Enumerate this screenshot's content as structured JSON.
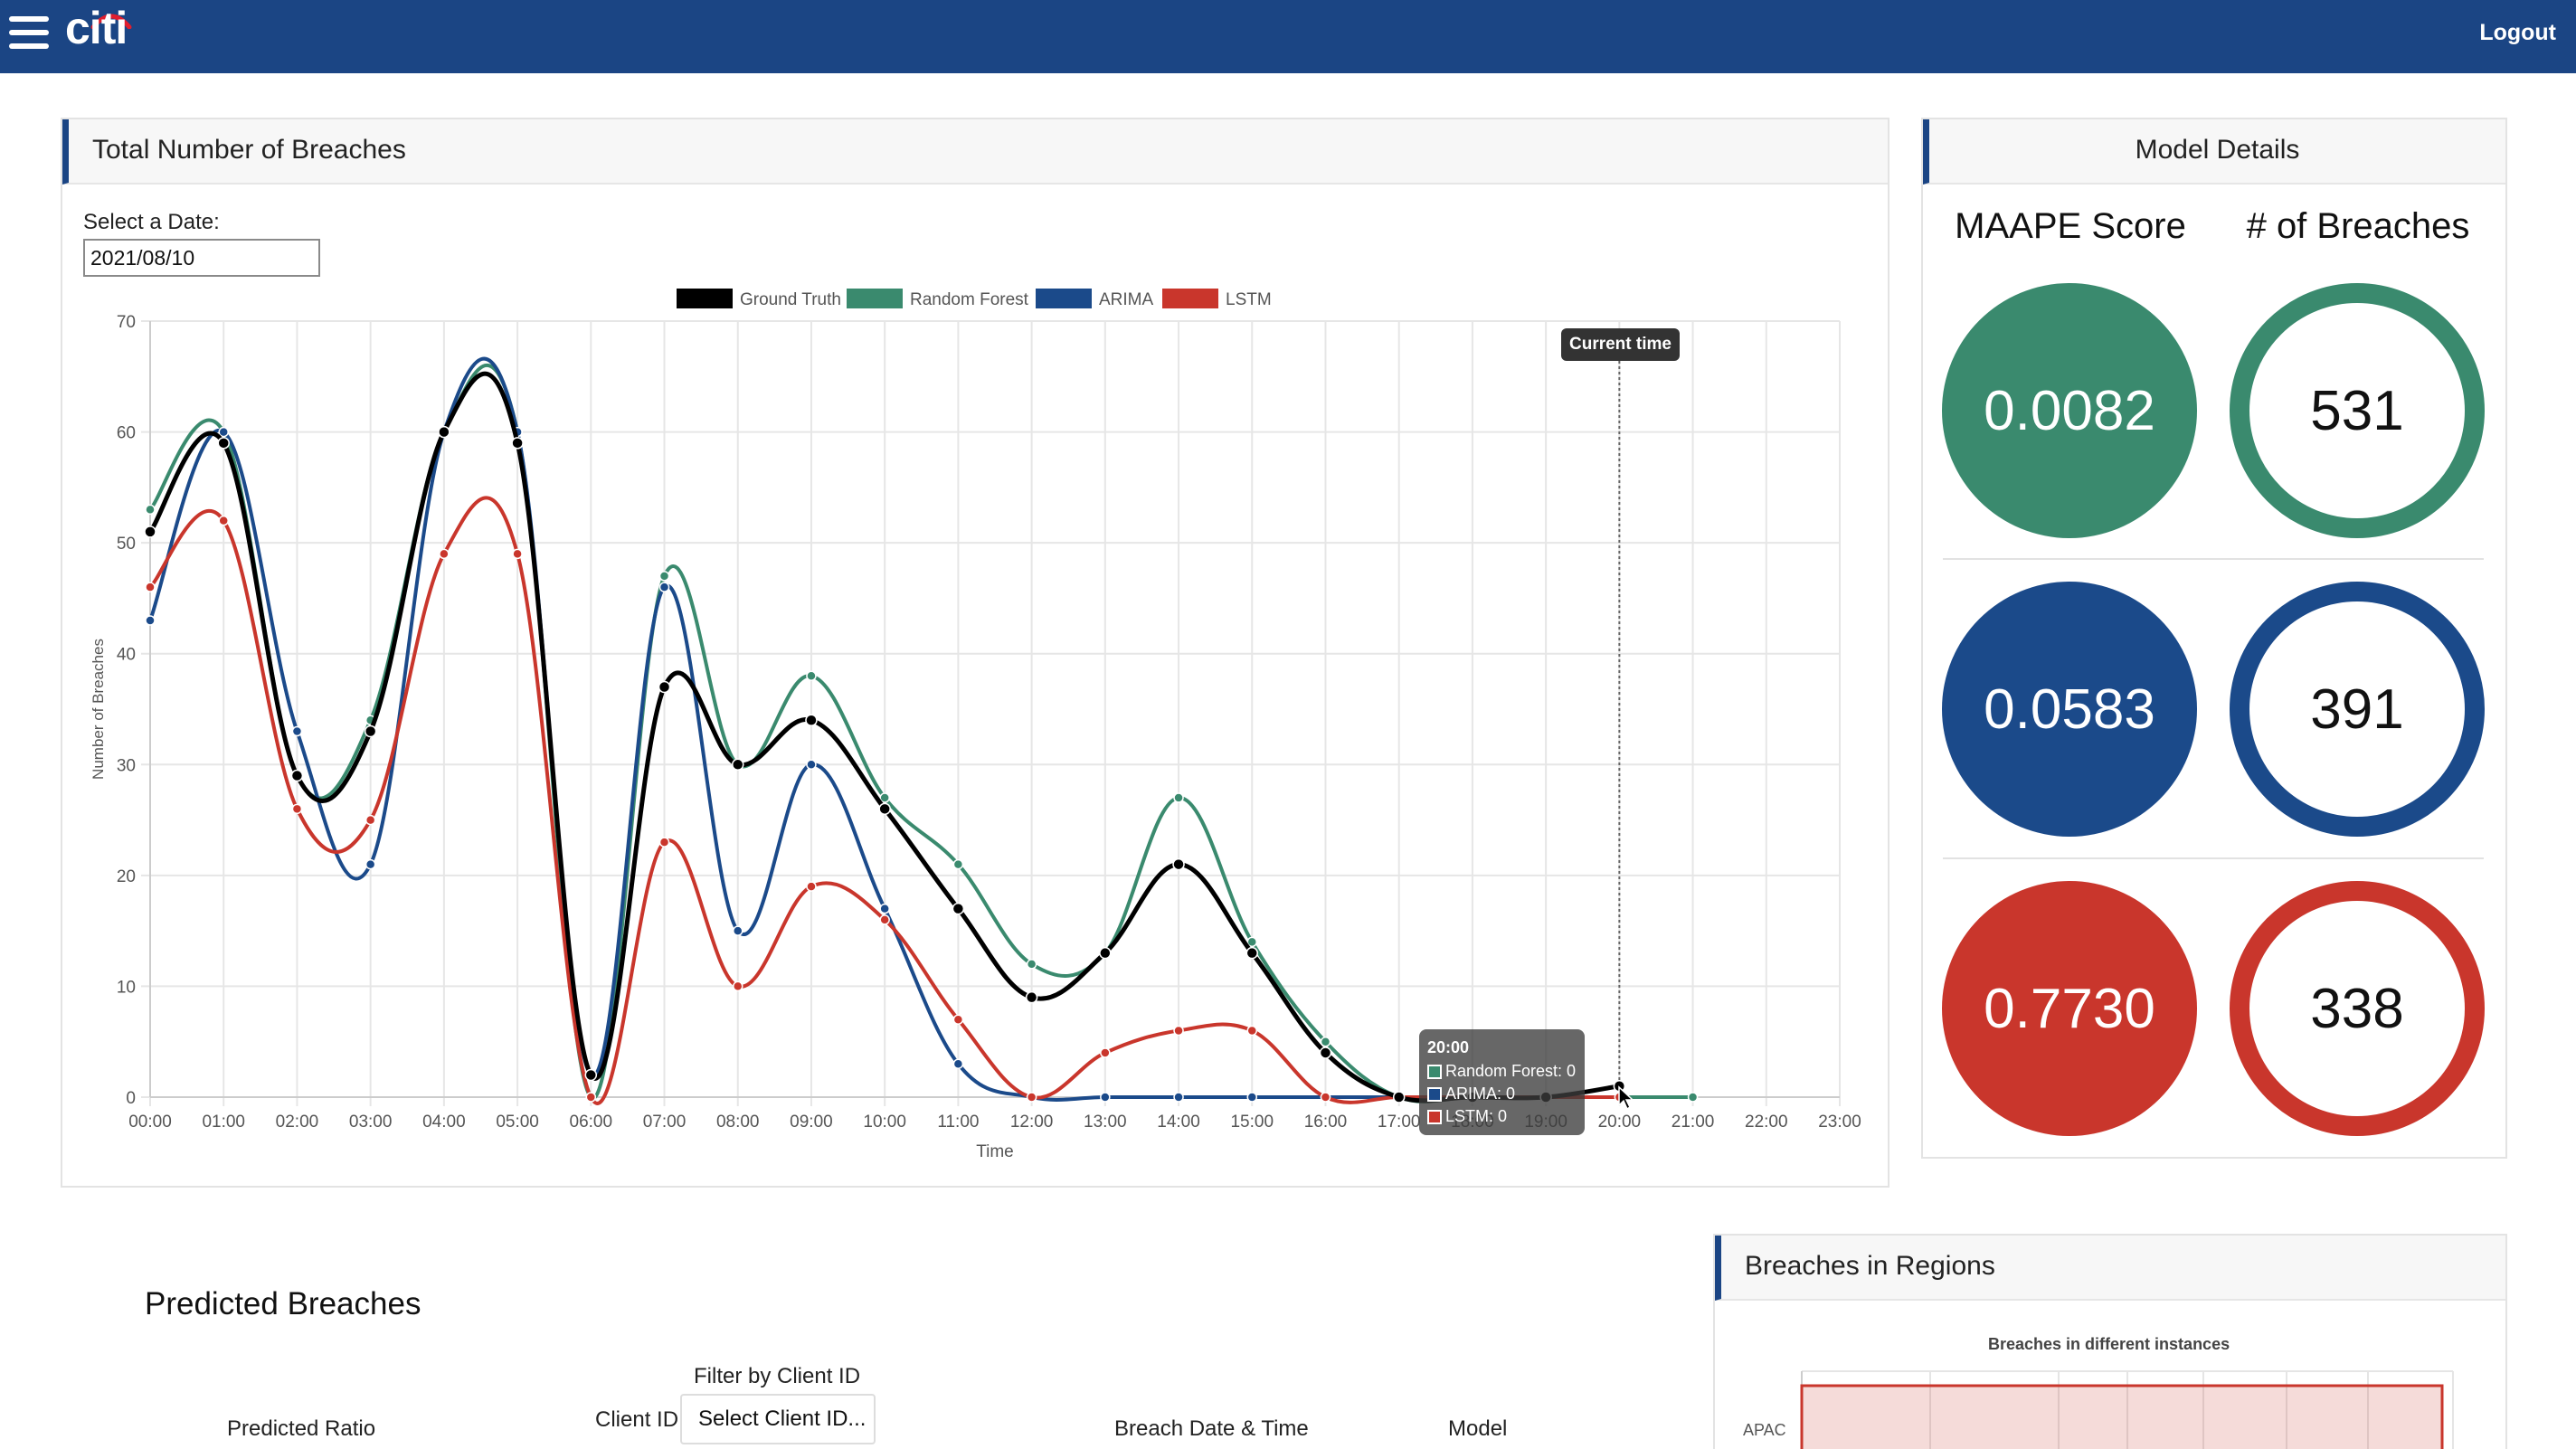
{
  "nav": {
    "logo_text": "citi",
    "logout_label": "Logout",
    "brand_color": "#1b4584"
  },
  "breaches_card": {
    "title": "Total Number of Breaches",
    "date_label": "Select a Date:",
    "date_value": "2021/08/10",
    "current_time_label": "Current time",
    "tooltip": {
      "title": "20:00",
      "rows": [
        "Random Forest: 0",
        "ARIMA: 0",
        "LSTM: 0"
      ]
    }
  },
  "chart_data": {
    "type": "line",
    "xlabel": "Time",
    "ylabel": "Number of Breaches",
    "ylim": [
      0,
      70
    ],
    "yticks": [
      0,
      10,
      20,
      30,
      40,
      50,
      60,
      70
    ],
    "categories": [
      "00:00",
      "01:00",
      "02:00",
      "03:00",
      "04:00",
      "05:00",
      "06:00",
      "07:00",
      "08:00",
      "09:00",
      "10:00",
      "11:00",
      "12:00",
      "13:00",
      "14:00",
      "15:00",
      "16:00",
      "17:00",
      "18:00",
      "19:00",
      "20:00",
      "21:00",
      "22:00",
      "23:00"
    ],
    "grid": true,
    "legend": "top",
    "current_time_marker": "20:00",
    "series": [
      {
        "name": "Random Forest",
        "color": "#3a8a6e",
        "values": [
          53,
          60,
          29,
          34,
          60,
          60,
          0,
          47,
          30,
          38,
          27,
          21,
          12,
          13,
          27,
          14,
          5,
          0,
          0,
          0,
          0,
          0,
          null,
          null
        ]
      },
      {
        "name": "ARIMA",
        "color": "#1b4a8a",
        "values": [
          43,
          60,
          33,
          21,
          60,
          60,
          2,
          46,
          15,
          30,
          17,
          3,
          0,
          0,
          0,
          0,
          0,
          0,
          0,
          0,
          0,
          null,
          null,
          null
        ]
      },
      {
        "name": "LSTM",
        "color": "#c9362c",
        "values": [
          46,
          52,
          26,
          25,
          49,
          49,
          0,
          23,
          10,
          19,
          16,
          7,
          0,
          4,
          6,
          6,
          0,
          0,
          0,
          0,
          0,
          null,
          null,
          null
        ]
      },
      {
        "name": "Ground Truth",
        "color": "#000000",
        "values": [
          51,
          59,
          29,
          33,
          60,
          59,
          2,
          37,
          30,
          34,
          26,
          17,
          9,
          13,
          21,
          13,
          4,
          0,
          0,
          0,
          1,
          null,
          null,
          null
        ]
      }
    ],
    "legend_order": [
      "Ground Truth",
      "Random Forest",
      "ARIMA",
      "LSTM"
    ]
  },
  "model_details": {
    "title": "Model Details",
    "maape_header": "MAAPE Score",
    "breaches_header": "# of Breaches",
    "rows": [
      {
        "maape": "0.0082",
        "breaches": "531",
        "color": "#3a8a6e"
      },
      {
        "maape": "0.0583",
        "breaches": "391",
        "color": "#1b4a8a"
      },
      {
        "maape": "0.7730",
        "breaches": "338",
        "color": "#c9362c"
      }
    ]
  },
  "predicted": {
    "title": "Predicted Breaches",
    "filter_label": "Filter by Client ID",
    "client_id_label": "Client ID",
    "client_select": "Select Client ID...",
    "col_ratio": "Predicted Ratio",
    "col_datetime": "Breach Date & Time",
    "col_model": "Model"
  },
  "regions": {
    "title": "Breaches in Regions",
    "chart_title": "Breaches in different instances",
    "first_category": "APAC"
  }
}
